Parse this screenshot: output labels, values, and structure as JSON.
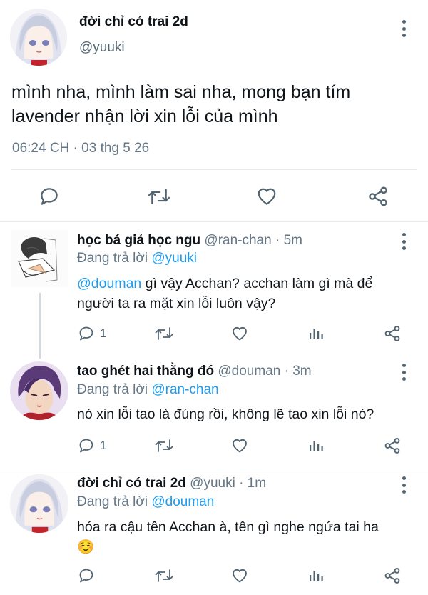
{
  "main_tweet": {
    "display_name": "đời chỉ có trai 2d",
    "handle": "@yuuki",
    "text_line1": "mình nha, mình làm sai nha, mong bạn tím",
    "text_line2": "lavender nhận lời xin lỗi của mình",
    "timestamp": "06:24 CH · 03 thg 5 26",
    "actions": [
      "reply-icon",
      "retweet-icon",
      "like-icon",
      "share-icon"
    ]
  },
  "replies": [
    {
      "display_name": "học bá giả học ngu",
      "meta": "@ran-chan · 5m",
      "replying_prefix": "Đang trả lời",
      "replying_to": "@yuuki",
      "mention": "@douman",
      "text_line1": " gì vậy Acchan? acchan làm gì mà để",
      "text_line2": "người ta ra mặt xin lỗi luôn vậy?",
      "reply_count": "1"
    },
    {
      "display_name": "tao ghét hai thằng đó",
      "meta": "@douman · 3m",
      "replying_prefix": "Đang trả lời",
      "replying_to": "@ran-chan",
      "text_line1": "nó xin lỗi tao là đúng rồi, không lẽ tao xin lỗi nó?",
      "reply_count": "1"
    },
    {
      "display_name": "đời chỉ có trai 2d",
      "meta": "@yuuki · 1m",
      "replying_prefix": "Đang trả lời",
      "replying_to": "@douman",
      "text_line1": "hóa ra cậu tên Acchan à, tên gì nghe ngứa tai ha",
      "text_line2": "☺️",
      "reply_count": ""
    }
  ],
  "colors": {
    "accent": "#1d9bf0",
    "icon": "#536471",
    "divider": "#e6ecf0"
  }
}
